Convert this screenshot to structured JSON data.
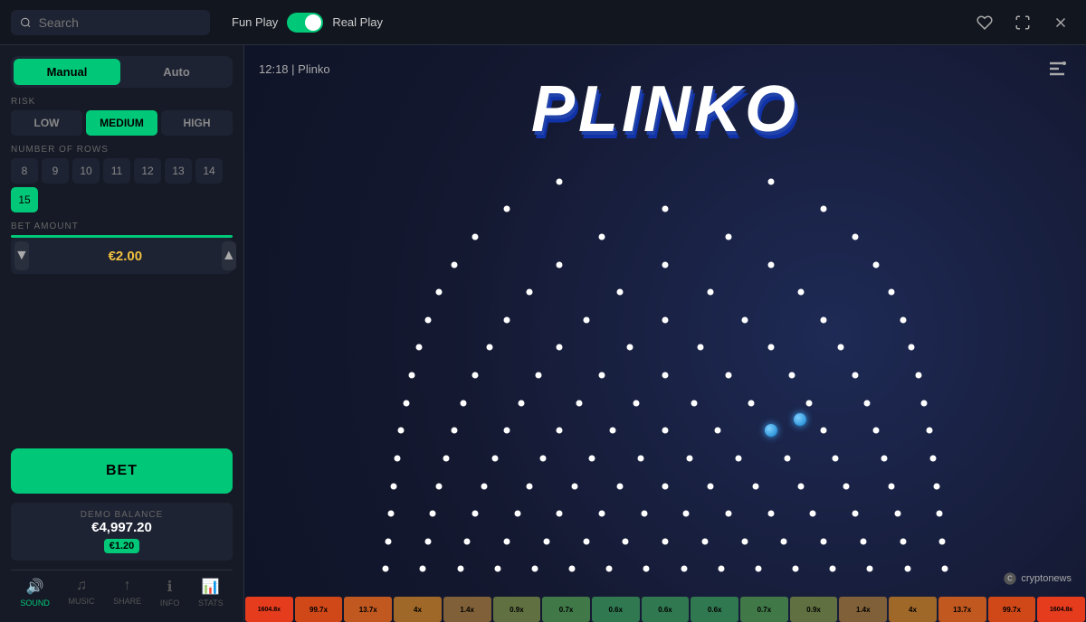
{
  "header": {
    "search_placeholder": "Search",
    "fun_play_label": "Fun Play",
    "real_play_label": "Real Play",
    "favorite_icon": "♥",
    "fullscreen_icon": "⛶",
    "close_icon": "✕"
  },
  "sidebar": {
    "tab_manual": "Manual",
    "tab_auto": "Auto",
    "active_tab": "manual",
    "risk_label": "RISK",
    "risk_options": [
      {
        "id": "low",
        "label": "LOW",
        "active": false
      },
      {
        "id": "medium",
        "label": "MEDIUM",
        "active": true
      },
      {
        "id": "high",
        "label": "HIGH",
        "active": false
      }
    ],
    "rows_label": "NUMBER OF ROWS",
    "row_values": [
      "8",
      "9",
      "10",
      "11",
      "12",
      "13",
      "14",
      "15"
    ],
    "active_row": "15",
    "bet_amount_label": "BET AMOUNT",
    "bet_value": "€2.00",
    "bet_button_label": "BET",
    "demo_balance_label": "DEMO BALANCE",
    "demo_amount": "€4,997.20",
    "balance_badge": "€1.20"
  },
  "bottom_nav": [
    {
      "id": "sound",
      "label": "SOUND",
      "icon": "🔊",
      "active": true
    },
    {
      "id": "music",
      "label": "MUSIC",
      "icon": "♪",
      "active": false
    },
    {
      "id": "share",
      "label": "SHARE",
      "icon": "↑",
      "active": false
    },
    {
      "id": "info",
      "label": "INFO",
      "icon": "ℹ",
      "active": false
    },
    {
      "id": "stats",
      "label": "STATS",
      "icon": "📊",
      "active": false
    }
  ],
  "game": {
    "time": "12:18",
    "separator": "|",
    "title_small": "Plinko",
    "title_big": "PLINKO",
    "menu_icon": "≡"
  },
  "buckets": [
    {
      "label": "1604.8x",
      "color": "#e63c1e"
    },
    {
      "label": "99.7x",
      "color": "#d04818"
    },
    {
      "label": "13.7x",
      "color": "#c05820"
    },
    {
      "label": "4x",
      "color": "#a06828"
    },
    {
      "label": "1.4x",
      "color": "#806038"
    },
    {
      "label": "0.9x",
      "color": "#607040"
    },
    {
      "label": "0.7x",
      "color": "#407848"
    },
    {
      "label": "0.6x",
      "color": "#307850"
    },
    {
      "label": "0.6x",
      "color": "#307850"
    },
    {
      "label": "0.6x",
      "color": "#307850"
    },
    {
      "label": "0.7x",
      "color": "#407848"
    },
    {
      "label": "0.9x",
      "color": "#607040"
    },
    {
      "label": "1.4x",
      "color": "#806038"
    },
    {
      "label": "4x",
      "color": "#a06828"
    },
    {
      "label": "13.7x",
      "color": "#c05820"
    },
    {
      "label": "99.7x",
      "color": "#d04818"
    },
    {
      "label": "1604.8x",
      "color": "#e63c1e"
    }
  ],
  "cryptonews": "cryptonews"
}
